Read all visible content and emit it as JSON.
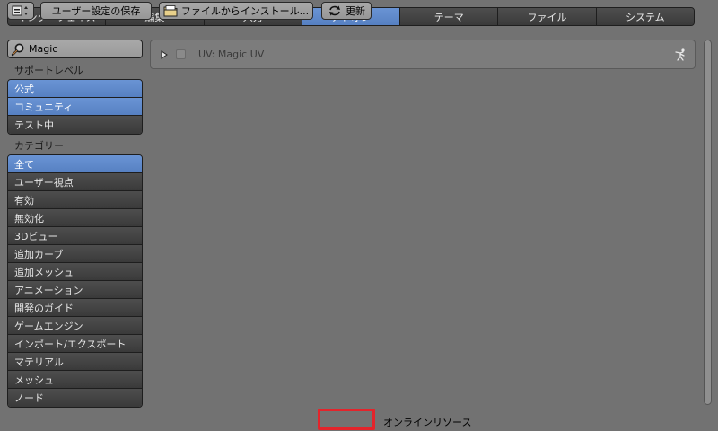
{
  "tabs": [
    {
      "label": "インターフェイス",
      "active": false
    },
    {
      "label": "編集",
      "active": false
    },
    {
      "label": "入力",
      "active": false
    },
    {
      "label": "アドオン",
      "active": true
    },
    {
      "label": "テーマ",
      "active": false
    },
    {
      "label": "ファイル",
      "active": false
    },
    {
      "label": "システム",
      "active": false
    }
  ],
  "search": {
    "value": "Magic",
    "icon": "search-icon"
  },
  "support_level": {
    "label": "サポートレベル",
    "items": [
      {
        "label": "公式",
        "active": true
      },
      {
        "label": "コミュニティ",
        "active": true
      },
      {
        "label": "テスト中",
        "active": false
      }
    ]
  },
  "category": {
    "label": "カテゴリー",
    "items": [
      {
        "label": "全て",
        "active": true
      },
      {
        "label": "ユーザー視点",
        "active": false
      },
      {
        "label": "有効",
        "active": false
      },
      {
        "label": "無効化",
        "active": false
      },
      {
        "label": "3Dビュー",
        "active": false
      },
      {
        "label": "追加カーブ",
        "active": false
      },
      {
        "label": "追加メッシュ",
        "active": false
      },
      {
        "label": "アニメーション",
        "active": false
      },
      {
        "label": "開発のガイド",
        "active": false
      },
      {
        "label": "ゲームエンジン",
        "active": false
      },
      {
        "label": "インポート/エクスポート",
        "active": false
      },
      {
        "label": "マテリアル",
        "active": false
      },
      {
        "label": "メッシュ",
        "active": false
      },
      {
        "label": "ノード",
        "active": false
      }
    ]
  },
  "addons": [
    {
      "name": "UV: Magic UV",
      "enabled": false,
      "expanded": false,
      "support_icon": "community-icon"
    }
  ],
  "bottom_bar": {
    "save_label": "ユーザー設定の保存",
    "install_label": "ファイルからインストール...",
    "refresh_label": "更新",
    "online_label": "オンラインリソース"
  },
  "colors": {
    "accent": "#5680c2",
    "background": "#727272",
    "highlight": "#e3242b"
  }
}
